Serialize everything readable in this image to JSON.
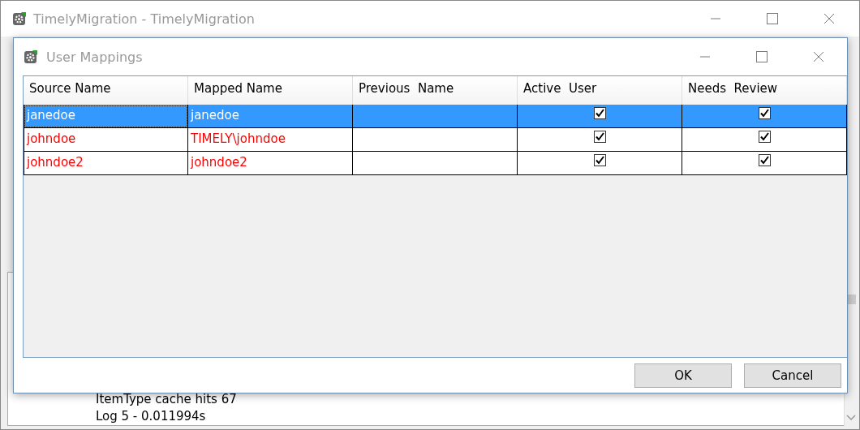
{
  "window": {
    "title": "TimelyMigration - TimelyMigration"
  },
  "log_lines": [
    "ItemType cache hits 67",
    "Log 5 - 0.011994s"
  ],
  "dialog": {
    "title": "User Mappings",
    "columns": [
      "Source Name",
      "Mapped Name",
      "Previous  Name",
      "Active  User",
      "Needs  Review"
    ],
    "rows": [
      {
        "source_name": "janedoe",
        "mapped_name": "janedoe",
        "active_user": true,
        "needs_review": true,
        "selected": true,
        "color": "#000000"
      },
      {
        "source_name": "johndoe",
        "mapped_name": "TIMELY\\johndoe",
        "active_user": true,
        "needs_review": true,
        "selected": false,
        "color": "#ff0000"
      },
      {
        "source_name": "johndoe2",
        "mapped_name": "johndoe2",
        "active_user": true,
        "needs_review": true,
        "selected": false,
        "color": "#ff0000"
      }
    ],
    "buttons": [
      "OK",
      "Cancel"
    ]
  }
}
